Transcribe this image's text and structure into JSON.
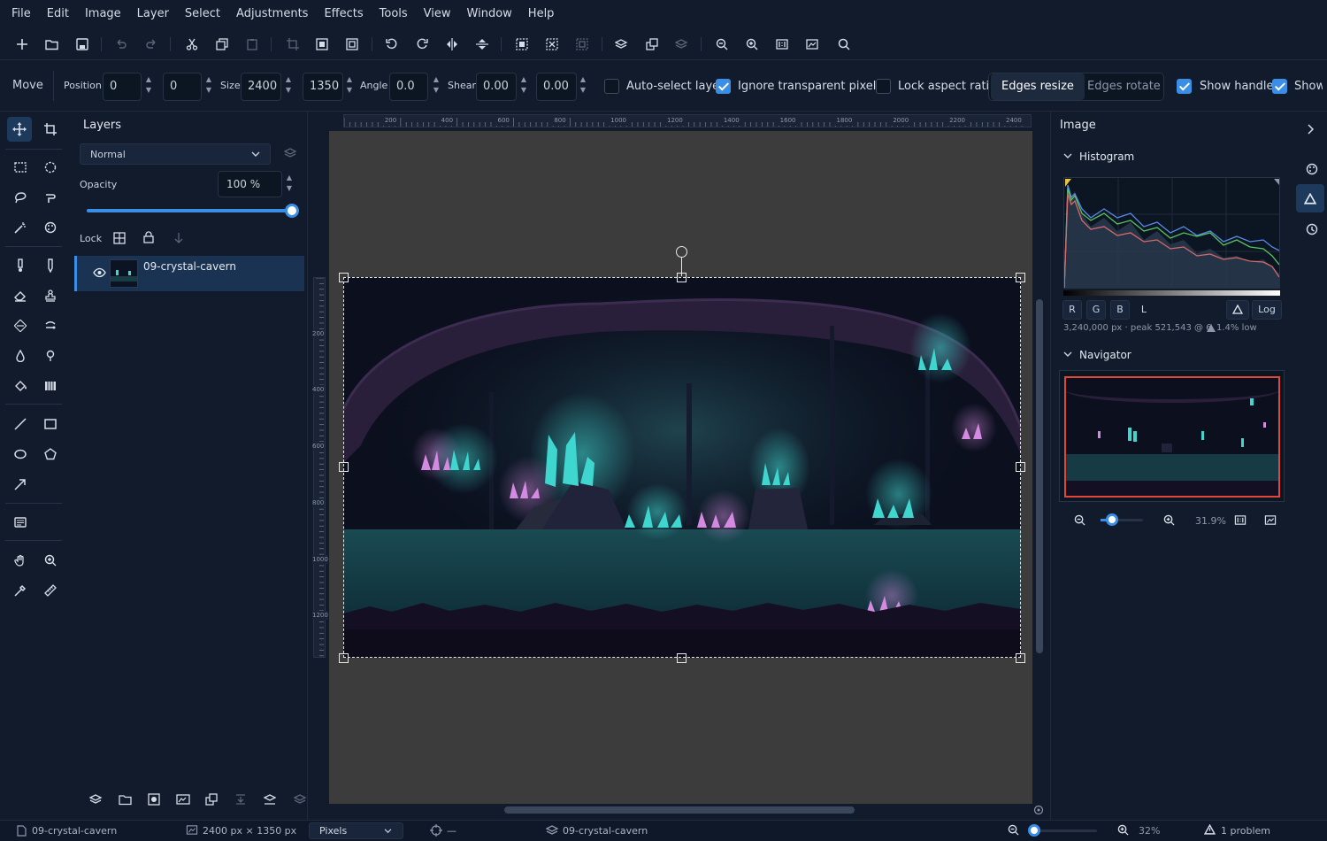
{
  "menu": [
    "File",
    "Edit",
    "Image",
    "Layer",
    "Select",
    "Adjustments",
    "Effects",
    "Tools",
    "View",
    "Window",
    "Help"
  ],
  "tool_options": {
    "tool_name": "Move",
    "position_label": "Position",
    "pos_x": "0",
    "pos_y": "0",
    "size_label": "Size",
    "width": "2400",
    "height": "1350",
    "angle_label": "Angle",
    "angle": "0.0",
    "shear_label": "Shear",
    "shear_x": "0.00",
    "shear_y": "0.00",
    "auto_select": {
      "label": "Auto-select layer",
      "checked": false
    },
    "ignore_transparent": {
      "label": "Ignore transparent pixels",
      "checked": true
    },
    "lock_aspect": {
      "label": "Lock aspect ratio",
      "checked": false
    },
    "edges_resize": "Edges resize",
    "edges_rotate": "Edges rotate",
    "show_handles": {
      "label": "Show handles",
      "checked": true
    },
    "show_truncated": {
      "label": "Show",
      "checked": true
    }
  },
  "layers_panel": {
    "title": "Layers",
    "blend_mode": "Normal",
    "opacity_label": "Opacity",
    "opacity_value": "100 %",
    "opacity_fraction": 1.0,
    "lock_label": "Lock",
    "layers": [
      {
        "name": "09-crystal-cavern",
        "visible": true,
        "selected": true
      }
    ]
  },
  "rulers": {
    "horizontal": [
      "200",
      "400",
      "600",
      "800",
      "1000",
      "1200",
      "1400",
      "1600",
      "1800",
      "2000",
      "2200",
      "2400"
    ],
    "vertical": [
      "200",
      "400",
      "600",
      "800",
      "1000",
      "1200"
    ]
  },
  "right_panel": {
    "title": "Image",
    "histogram_title": "Histogram",
    "channels": [
      "R",
      "G",
      "B",
      "L"
    ],
    "log_label": "Log",
    "stats": "3,240,000 px · peak 521,543 @ 6",
    "warning_text": "1.4% low",
    "navigator_title": "Navigator",
    "zoom_percent": "31.9%",
    "zoom_fraction": 0.2
  },
  "status": {
    "document": "09-crystal-cavern",
    "dimensions": "2400 px × 1350 px",
    "units": "Pixels",
    "cursor": "—",
    "layer": "09-crystal-cavern",
    "zoom": "32%",
    "problems": "1 problem"
  },
  "colors": {
    "accent": "#3a8ee6",
    "background": "#111b2b",
    "canvas_bg": "#3c3c3c",
    "crystal_teal": "#3fd6cf",
    "crystal_pink": "#d48ae0",
    "navigator_frame": "#e0473a"
  }
}
